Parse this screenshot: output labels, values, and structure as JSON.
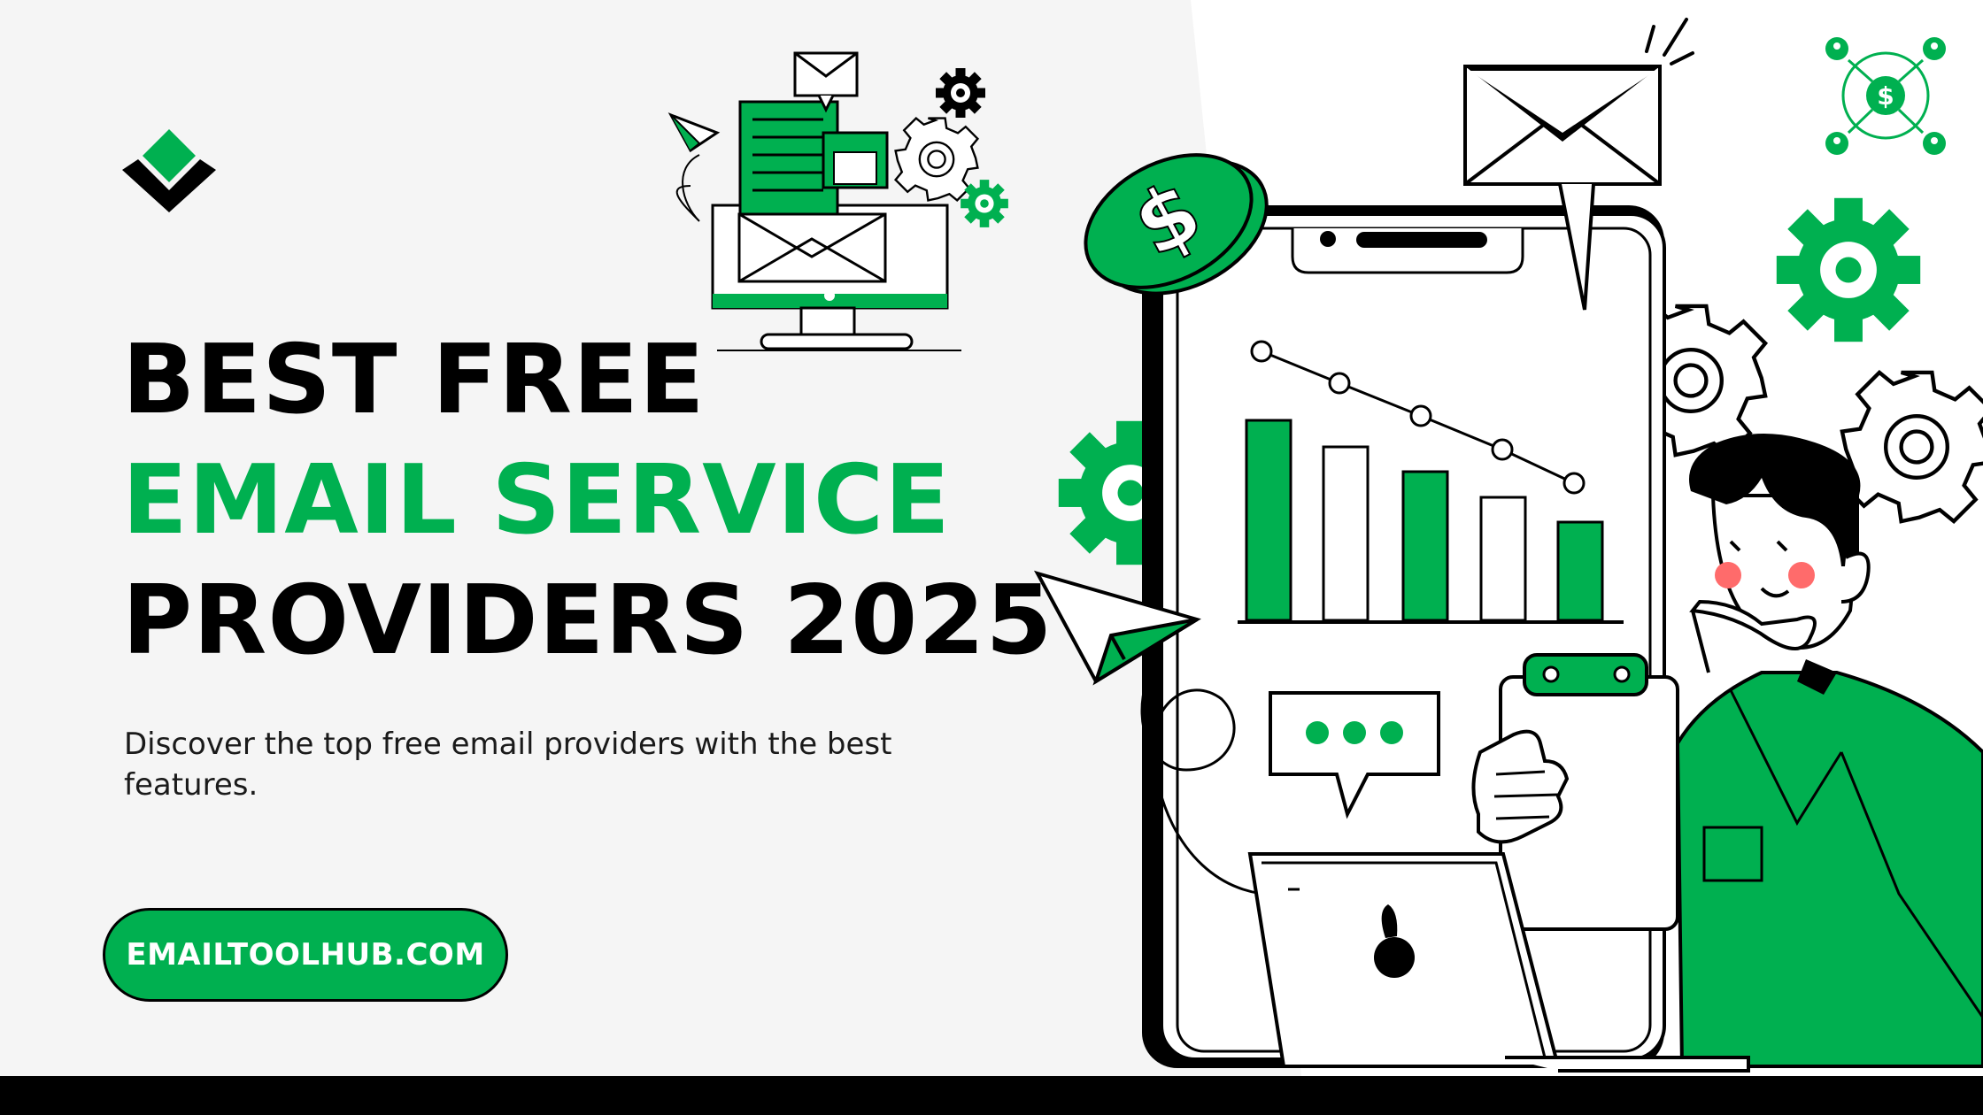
{
  "brand": {
    "accent_color": "#00b050",
    "logo_icon": "diamond-chevron-logo-icon"
  },
  "hero": {
    "title_line_1": "BEST FREE",
    "title_line_2": "EMAIL SERVICE",
    "title_line_3": "PROVIDERS 2025",
    "subtitle": "Discover the top free email providers with the best features."
  },
  "cta": {
    "label": "EMAILTOOLHUB.COM"
  },
  "illustration": {
    "icons": [
      "email-envelope-icon",
      "gear-icon",
      "dollar-coin-icon",
      "bar-chart-icon",
      "paper-plane-icon",
      "chat-bubble-icon",
      "clipboard-icon",
      "laptop-icon",
      "person-thinking-icon",
      "network-dollar-icon"
    ]
  }
}
